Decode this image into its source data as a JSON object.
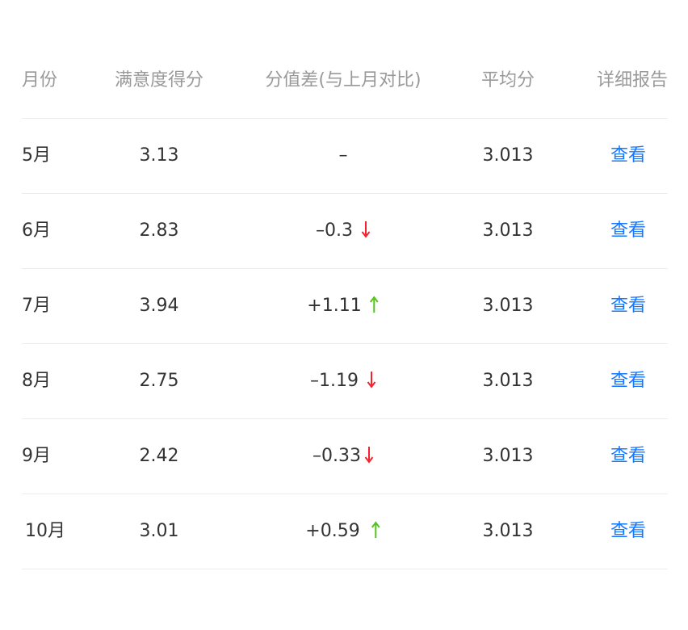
{
  "table": {
    "headers": {
      "month": "月份",
      "score": "满意度得分",
      "diff": "分值差(与上月对比)",
      "avg": "平均分",
      "report": "详细报告"
    },
    "rows": [
      {
        "month": "5月",
        "score": "3.13",
        "diff": "–",
        "trend": "none",
        "avg": "3.013",
        "report": "查看"
      },
      {
        "month": "6月",
        "score": "2.83",
        "diff": "–0.3",
        "trend": "down",
        "avg": "3.013",
        "report": "查看"
      },
      {
        "month": "7月",
        "score": "3.94",
        "diff": "+1.11",
        "trend": "up",
        "avg": "3.013",
        "report": "查看"
      },
      {
        "month": "8月",
        "score": "2.75",
        "diff": "–1.19",
        "trend": "down",
        "avg": "3.013",
        "report": "查看"
      },
      {
        "month": "9月",
        "score": "2.42",
        "diff": "–0.33",
        "trend": "down",
        "avg": "3.013",
        "report": "查看"
      },
      {
        "month": "10月",
        "score": "3.01",
        "diff": "+0.59",
        "trend": "up",
        "avg": "3.013",
        "report": "查看"
      }
    ]
  },
  "colors": {
    "up": "#52c41a",
    "down": "#f5222d",
    "link": "#1677ff",
    "header_text": "#999999",
    "body_text": "#333333",
    "divider": "#ececec"
  },
  "icons": {
    "up": "arrow-up-icon",
    "down": "arrow-down-icon"
  }
}
